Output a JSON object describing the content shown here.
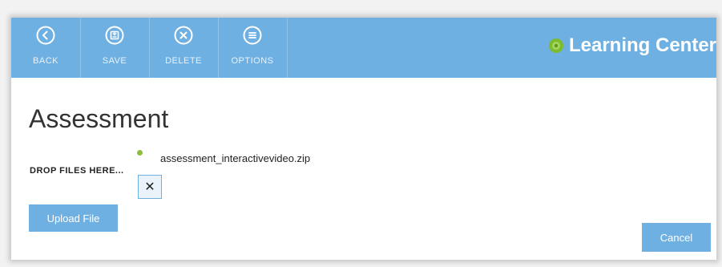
{
  "toolbar": {
    "buttons": [
      {
        "label": "BACK",
        "icon": "back-circle-icon"
      },
      {
        "label": "SAVE",
        "icon": "save-circle-icon"
      },
      {
        "label": "DELETE",
        "icon": "delete-circle-icon"
      },
      {
        "label": "OPTIONS",
        "icon": "options-circle-icon"
      }
    ],
    "brand": "Learning Center",
    "colors": {
      "toolbar_bg": "#6fb0e2",
      "logo_green": "#7dbb2f"
    }
  },
  "page": {
    "title": "Assessment",
    "drop_label": "DROP FILES HERE...",
    "file": {
      "name": "assessment_interactivevideo.zip",
      "remove_symbol": "✕"
    },
    "upload_label": "Upload File",
    "cancel_label": "Cancel"
  }
}
